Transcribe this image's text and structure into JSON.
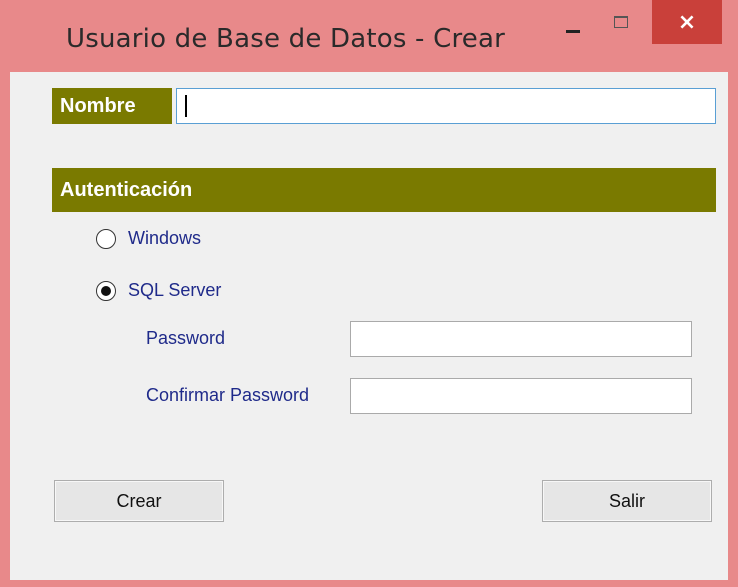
{
  "window": {
    "title": "Usuario de Base de Datos - Crear",
    "minimize_icon": "minimize-icon",
    "maximize_icon": "maximize-icon",
    "close_symbol": "×"
  },
  "form": {
    "nombre_label": "Nombre",
    "nombre_value": "",
    "auth_header": "Autenticación",
    "auth_options": [
      {
        "label": "Windows",
        "selected": false
      },
      {
        "label": "SQL Server",
        "selected": true
      }
    ],
    "password_label": "Password",
    "password_value": "",
    "confirm_label": "Confirmar Password",
    "confirm_value": ""
  },
  "buttons": {
    "create": "Crear",
    "exit": "Salir"
  },
  "colors": {
    "header_bg": "#7a7a00",
    "title_bar": "#e8898a",
    "close_button": "#c9403a",
    "label_text": "#1f2a8a"
  }
}
